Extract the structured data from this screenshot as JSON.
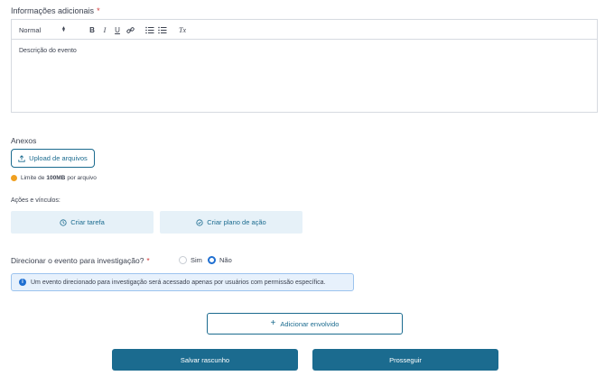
{
  "info_section": {
    "title": "Informações adicionais",
    "required_mark": "*",
    "toolbar": {
      "format_value": "Normal",
      "bold": "B",
      "italic": "I",
      "underline": "U",
      "clear_format": "Tx"
    },
    "content": "Descrição do evento"
  },
  "attachments": {
    "title": "Anexos",
    "upload_label": "Upload de arquivos",
    "limit_prefix": "Limite de",
    "limit_value": "100MB",
    "limit_suffix": "por arquivo"
  },
  "actions": {
    "title": "Ações e vínculos:",
    "create_task": "Criar tarefa",
    "create_plan": "Criar plano de ação"
  },
  "investigation": {
    "question": "Direcionar o evento para investigação?",
    "required_mark": "*",
    "option_yes": "Sim",
    "option_no": "Não",
    "selected": "Não",
    "info_text": "Um evento direcionado para investigação será acessado apenas por usuários com permissão específica."
  },
  "buttons": {
    "add_involved": "Adicionar envolvido",
    "save_draft": "Salvar rascunho",
    "proceed": "Prosseguir"
  },
  "colors": {
    "primary": "#1b6b8f",
    "required": "#d33a3a",
    "info": "#1f6fd1",
    "warning": "#f0a020"
  }
}
